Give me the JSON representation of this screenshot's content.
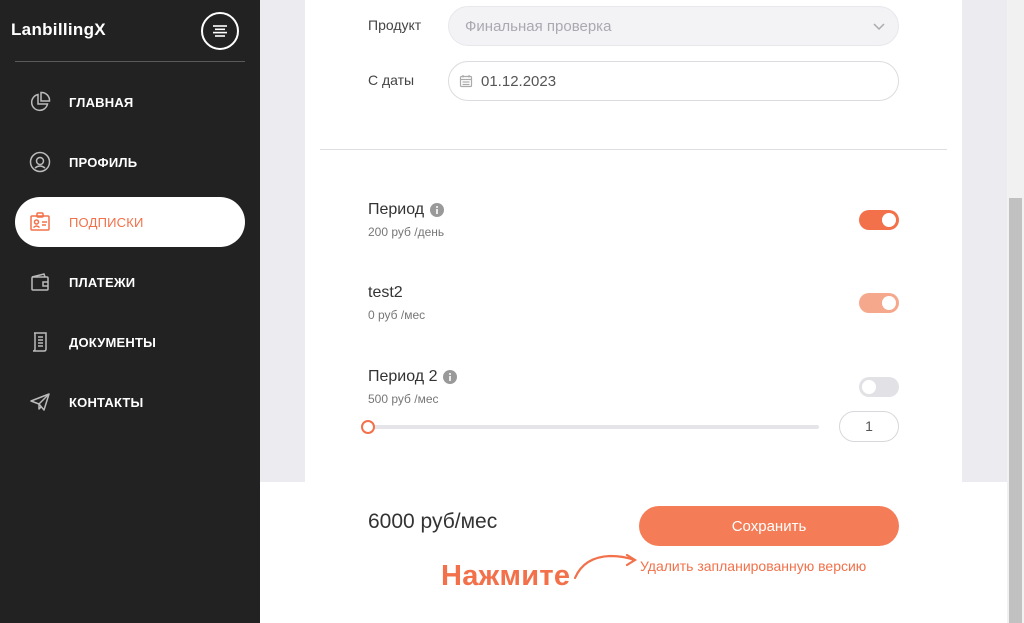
{
  "app": {
    "brand": "LanbillingX"
  },
  "sidebar": {
    "items": [
      {
        "label": "ГЛАВНАЯ",
        "icon": "pie-chart-icon"
      },
      {
        "label": "ПРОФИЛЬ",
        "icon": "user-circle-icon"
      },
      {
        "label": "ПОДПИСКИ",
        "icon": "id-card-icon",
        "active": true
      },
      {
        "label": "ПЛАТЕЖИ",
        "icon": "wallet-icon"
      },
      {
        "label": "ДОКУМЕНТЫ",
        "icon": "document-icon"
      },
      {
        "label": "КОНТАКТЫ",
        "icon": "paper-plane-icon"
      }
    ]
  },
  "form": {
    "product_label": "Продукт",
    "product_value": "Финальная проверка",
    "date_label": "С даты",
    "date_value": "01.12.2023"
  },
  "plans": [
    {
      "name": "Период",
      "price": "200 руб /день",
      "has_info": true,
      "enabled": true
    },
    {
      "name": "test2",
      "price": "0 руб /мес",
      "has_info": false,
      "enabled": true,
      "disabled_style": true
    },
    {
      "name": "Период 2",
      "price": "500 руб /мес",
      "has_info": true,
      "enabled": false,
      "quantity": "1",
      "slider_level": 0
    }
  ],
  "footer": {
    "total": "6000 руб/мес",
    "save_label": "Сохранить",
    "delete_label": "Удалить запланированную версию",
    "hint_label": "Нажмите"
  },
  "colors": {
    "accent": "#f2714a",
    "sidebar_bg": "#222222",
    "main_bg": "#ececf0"
  }
}
